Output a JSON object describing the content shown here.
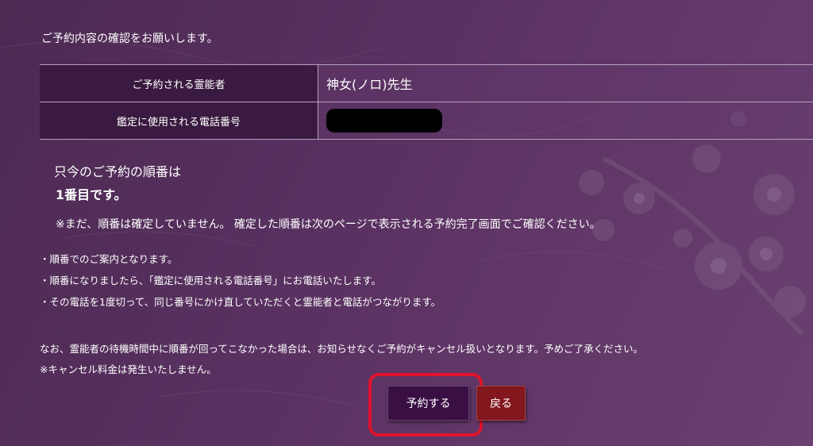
{
  "intro": "ご予約内容の確認をお願いします。",
  "details": {
    "rows": [
      {
        "label": "ご予約される霊能者",
        "value": "神女(ノロ)先生"
      },
      {
        "label": "鑑定に使用される電話番号",
        "value": ""
      }
    ]
  },
  "order": {
    "lead": "只今のご予約の順番は",
    "number": "1番目です。",
    "note": "※まだ、順番は確定していません。 確定した順番は次のページで表示される予約完了画面でご確認ください。"
  },
  "bullets": [
    "・順番でのご案内となります。",
    "・順番になりましたら、「鑑定に使用される電話番号」にお電話いたします。",
    "・その電話を1度切って、同じ番号にかけ直していただくと霊能者と電話がつながります。"
  ],
  "notice": "なお、霊能者の待機時間中に順番が回ってこなかった場合は、お知らせなくご予約がキャンセル扱いとなります。予めご了承ください。",
  "cancel_fee": "※キャンセル料金は発生いたしません。",
  "buttons": {
    "reserve": "予約する",
    "back": "戻る"
  },
  "colors": {
    "background": "#5a3262",
    "table_header": "#3a1a40",
    "reserve_button": "#3a0f44",
    "back_button": "#82171e",
    "highlight": "#e0132c"
  }
}
